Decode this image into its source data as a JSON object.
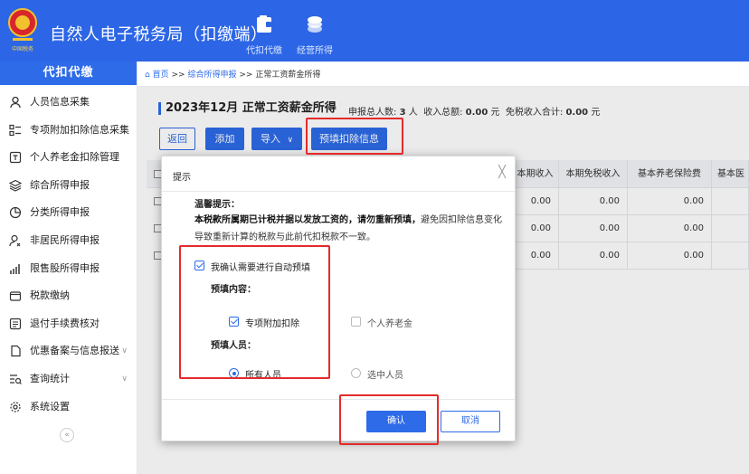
{
  "header": {
    "title": "自然人电子税务局（扣缴端）",
    "nav": [
      {
        "label": "代扣代缴",
        "icon": "tax-withholding-icon"
      },
      {
        "label": "经营所得",
        "icon": "business-income-icon"
      }
    ]
  },
  "sidebar": {
    "section_title": "代扣代缴",
    "items": [
      {
        "label": "人员信息采集",
        "icon": "person-icon"
      },
      {
        "label": "专项附加扣除信息采集",
        "icon": "grid-list-icon"
      },
      {
        "label": "个人养老金扣除管理",
        "icon": "pension-icon"
      },
      {
        "label": "综合所得申报",
        "icon": "layers-icon"
      },
      {
        "label": "分类所得申报",
        "icon": "pie-chart-icon"
      },
      {
        "label": "非居民所得申报",
        "icon": "nonresident-icon"
      },
      {
        "label": "限售股所得申报",
        "icon": "bar-chart-icon"
      },
      {
        "label": "税款缴纳",
        "icon": "wallet-icon"
      },
      {
        "label": "退付手续费核对",
        "icon": "checklist-icon"
      },
      {
        "label": "优惠备案与信息报送",
        "icon": "document-icon"
      },
      {
        "label": "查询统计",
        "icon": "search-list-icon"
      },
      {
        "label": "系统设置",
        "icon": "gear-icon"
      }
    ],
    "collapse_glyph": "«"
  },
  "breadcrumb": {
    "home": "首页",
    "sep1": ">>",
    "level2": "综合所得申报",
    "sep2": ">>",
    "current": "正常工资薪金所得"
  },
  "page": {
    "title": "2023年12月 正常工资薪金所得",
    "summary": {
      "people_label": "申报总人数:",
      "people_value": "3",
      "people_unit": "人",
      "income_label": "收入总额:",
      "income_value": "0.00",
      "income_unit": "元",
      "exempt_label": "免税收入合计:",
      "exempt_value": "0.00",
      "exempt_unit": "元"
    }
  },
  "toolbar": {
    "back": "返回",
    "add": "添加",
    "import": "导入",
    "import_caret": "∨",
    "prefill": "预填扣除信息"
  },
  "table": {
    "columns": [
      "本期收入",
      "本期免税收入",
      "基本养老保险费",
      "基本医"
    ],
    "rows": [
      [
        "0.00",
        "0.00",
        "0.00",
        ""
      ],
      [
        "0.00",
        "0.00",
        "0.00",
        ""
      ],
      [
        "0.00",
        "0.00",
        "0.00",
        ""
      ]
    ]
  },
  "dialog": {
    "title": "提示",
    "close_glyph": "╳",
    "tip_title": "温馨提示：",
    "tip_bold": "本税款所属期已计税并据以发放工资的，请勿重新预填，",
    "tip_rest": "避免因扣除信息变化导致重新计算的税款与此前代扣税款不一致。",
    "confirm_checkbox": "我确认需要进行自动预填",
    "content_title": "预填内容：",
    "option_special": "专项附加扣除",
    "option_pension": "个人养老金",
    "people_title": "预填人员：",
    "option_all": "所有人员",
    "option_selected": "选中人员",
    "ok": "确认",
    "cancel": "取消"
  },
  "colors": {
    "brand_blue": "#2c66e6",
    "highlight_red": "#e32b2b"
  }
}
